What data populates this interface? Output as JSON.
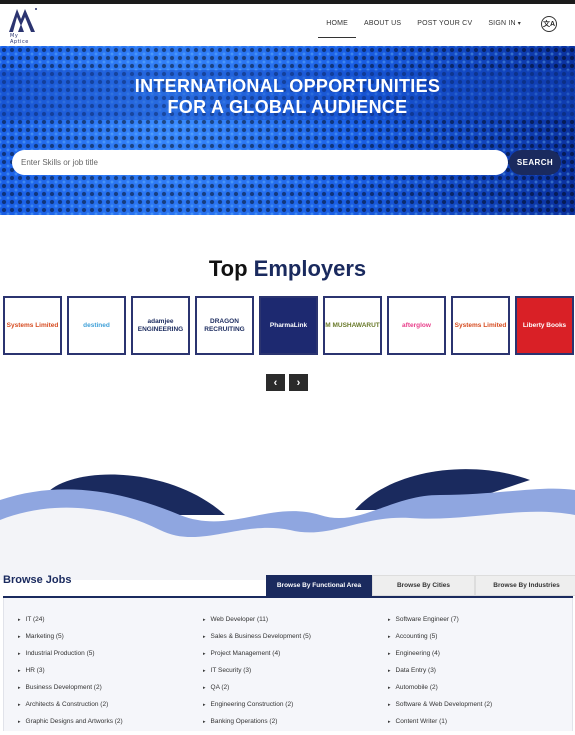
{
  "header": {
    "logo_text": "My Aptice",
    "logo_mark": "MA",
    "nav": [
      "HOME",
      "ABOUT US",
      "POST YOUR CV",
      "SIGN IN"
    ],
    "lang_icon": "translate-icon"
  },
  "hero": {
    "title_line1": "INTERNATIONAL OPPORTUNITIES",
    "title_line2": "FOR A GLOBAL AUDIENCE",
    "search_placeholder": "Enter Skills or job title",
    "search_button": "SEARCH"
  },
  "employers": {
    "title_strong": "Top",
    "title_rest": "Employers",
    "logos": [
      {
        "name": "Systems Limited",
        "text": "Systems Limited",
        "color": "#d64a1e",
        "bg": "#ffffff"
      },
      {
        "name": "destined",
        "text": "destined",
        "color": "#3fa0d8",
        "bg": "#ffffff"
      },
      {
        "name": "adamjee engineering",
        "text": "adamjee ENGINEERING",
        "color": "#1a2a5e",
        "bg": "#ffffff"
      },
      {
        "name": "Dragon Recruiting",
        "text": "DRAGON RECRUITING",
        "color": "#1a2a5e",
        "bg": "#ffffff"
      },
      {
        "name": "PharmaLink",
        "text": "PharmaLink",
        "color": "#ffffff",
        "bg": "#1d2970"
      },
      {
        "name": "Mushawarat",
        "text": "M MUSHAWARUT",
        "color": "#6a7a2a",
        "bg": "#ffffff"
      },
      {
        "name": "afterglow",
        "text": "afterglow",
        "color": "#e83d8a",
        "bg": "#ffffff"
      },
      {
        "name": "Systems Limited",
        "text": "Systems Limited",
        "color": "#d64a1e",
        "bg": "#ffffff"
      },
      {
        "name": "Liberty Books",
        "text": "Liberty Books",
        "color": "#ffffff",
        "bg": "#d92026"
      }
    ],
    "prev_icon": "chevron-left-icon",
    "next_icon": "chevron-right-icon"
  },
  "browse": {
    "title": "Browse Jobs",
    "tabs": [
      "Browse By Functional Area",
      "Browse By Cities",
      "Browse By Industries"
    ],
    "columns": [
      [
        "IT (24)",
        "Marketing (5)",
        "Industrial Production (5)",
        "HR (3)",
        "Business Development (2)",
        "Architects & Construction (2)",
        "Graphic Designs and Artworks (2)"
      ],
      [
        "Web Developer (11)",
        "Sales & Business Development (5)",
        "Project Management (4)",
        "IT Security (3)",
        "QA (2)",
        "Engineering Construction (2)",
        "Banking Operations (2)"
      ],
      [
        "Software Engineer (7)",
        "Accounting (5)",
        "Engineering (4)",
        "Data Entry (3)",
        "Automobile (2)",
        "Software & Web Development (2)",
        "Content Writer (1)"
      ]
    ]
  },
  "colors": {
    "navy": "#1a2a5e",
    "hero_blue": "#1a5fe6",
    "wave_light": "#8fa6e0"
  }
}
